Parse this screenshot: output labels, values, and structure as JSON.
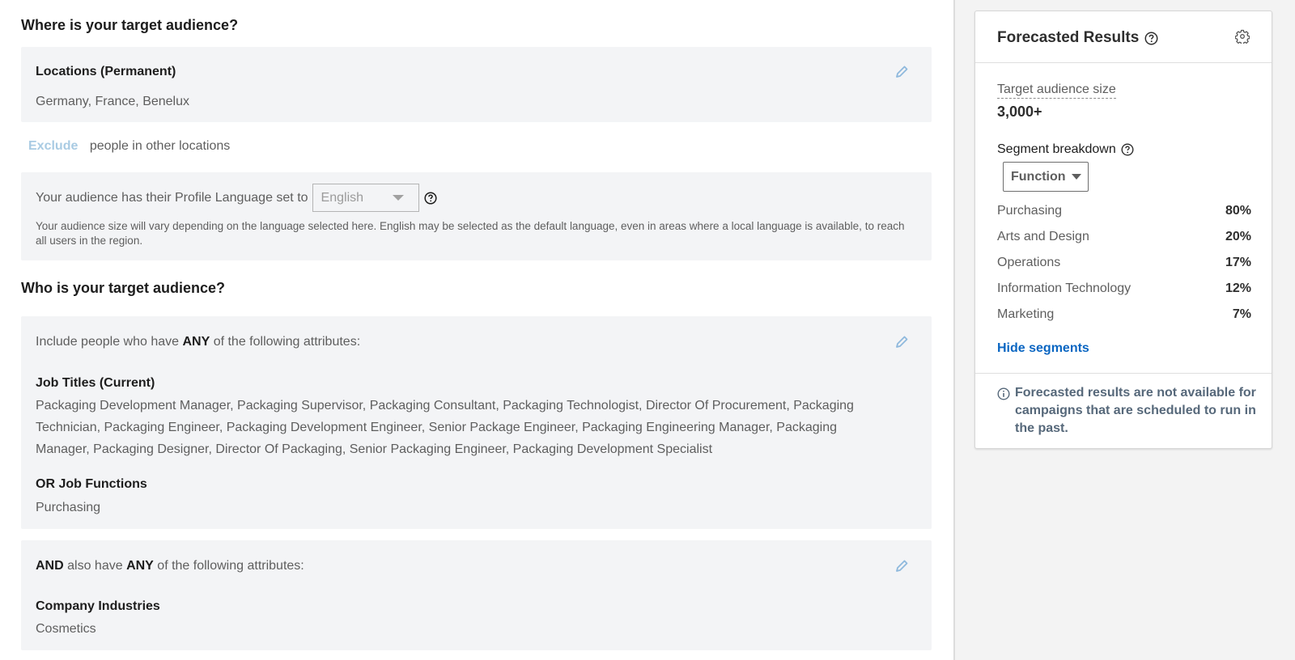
{
  "where_section": {
    "heading": "Where is your target audience?",
    "locations": {
      "label": "Locations (Permanent)",
      "value": "Germany, France, Benelux"
    },
    "exclude": {
      "link": "Exclude",
      "text": "people in other locations"
    },
    "language": {
      "prefix": "Your audience has their Profile Language set to",
      "selected": "English",
      "note": "Your audience size will vary depending on the language selected here. English may be selected as the default language, even in areas where a local language is available, to reach all users in the region."
    }
  },
  "who_section": {
    "heading": "Who is your target audience?",
    "include_block": {
      "intro_pre": "Include people who have ",
      "intro_bold": "ANY",
      "intro_post": " of the following attributes:",
      "job_titles_label": "Job Titles (Current)",
      "job_titles_value": "Packaging Development Manager, Packaging Supervisor, Packaging Consultant, Packaging Technologist, Director Of Procurement, Packaging Technician, Packaging Engineer, Packaging Development Engineer, Senior Package Engineer, Packaging Engineering Manager, Packaging Manager, Packaging Designer, Director Of Packaging, Senior Packaging Engineer, Packaging Development Specialist",
      "job_functions_label": "OR Job Functions",
      "job_functions_value": "Purchasing"
    },
    "and_block": {
      "intro_bold1": "AND",
      "intro_mid": " also have ",
      "intro_bold2": "ANY",
      "intro_post": " of the following attributes:",
      "industries_label": "Company Industries",
      "industries_value": "Cosmetics"
    }
  },
  "forecast": {
    "title": "Forecasted Results",
    "target_audience_label": "Target audience size",
    "target_audience_value": "3,000+",
    "segment_label": "Segment breakdown",
    "segment_select": "Function",
    "segments": [
      {
        "name": "Purchasing",
        "pct": "80%"
      },
      {
        "name": "Arts and Design",
        "pct": "20%"
      },
      {
        "name": "Operations",
        "pct": "17%"
      },
      {
        "name": "Information Technology",
        "pct": "12%"
      },
      {
        "name": "Marketing",
        "pct": "7%"
      }
    ],
    "hide_link": "Hide segments",
    "info_text": "Forecasted results are not available for campaigns that are scheduled to run in the past."
  },
  "colors": {
    "accent_link": "#0a66c2",
    "info_text": "#56687a",
    "panel_bg": "#f3f4f6",
    "edit_icon": "#8fb9dd"
  }
}
